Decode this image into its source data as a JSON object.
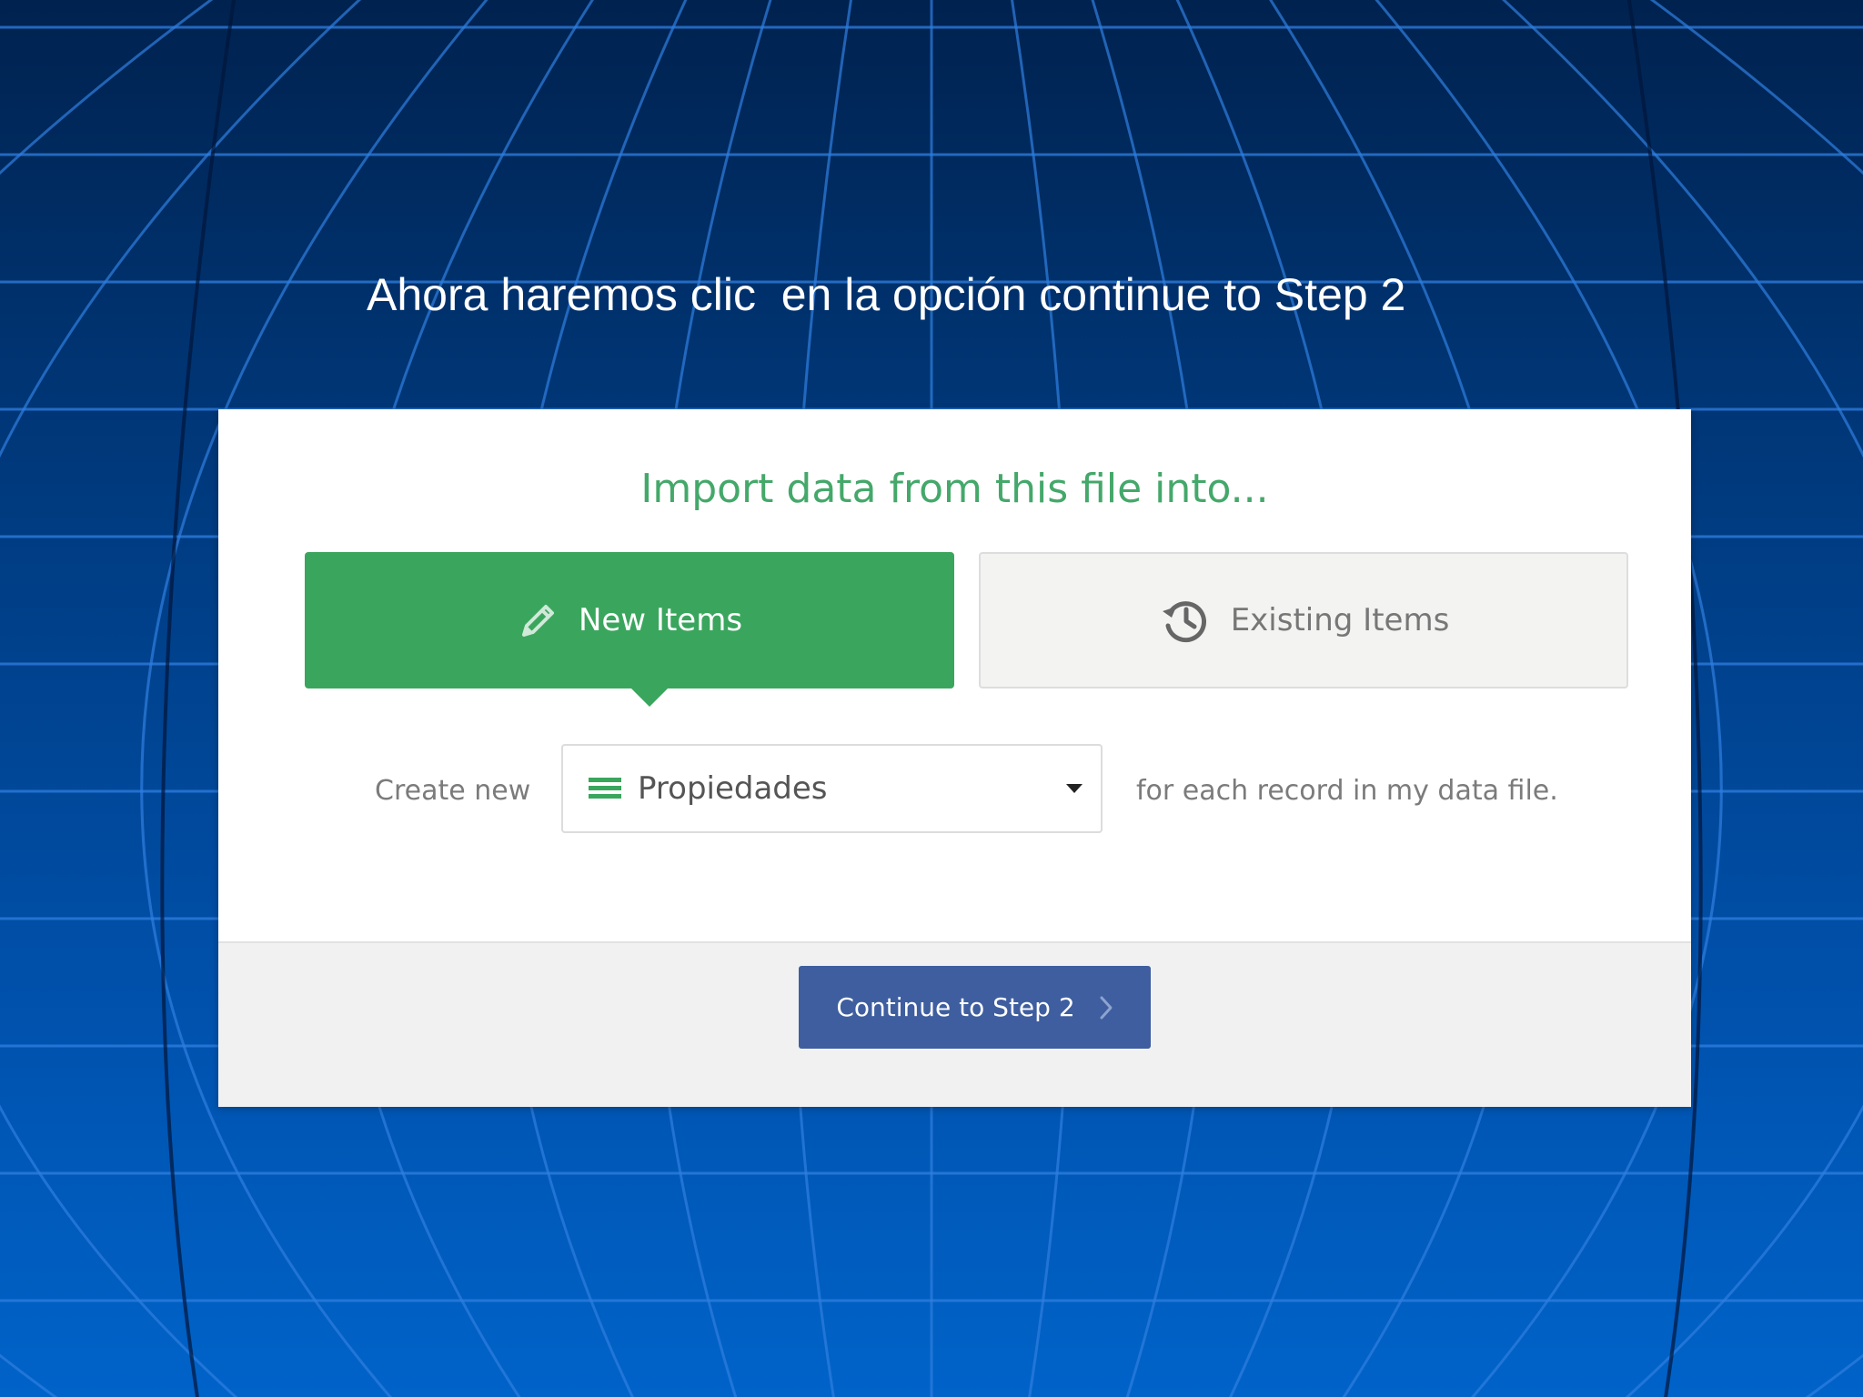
{
  "slide": {
    "title": "Ahora haremos clic  en la opción continue to Step 2"
  },
  "dialog": {
    "heading": "Import data from this file into...",
    "options": {
      "new_items": {
        "label": "New Items",
        "icon": "pencil-icon",
        "selected": true
      },
      "existing_items": {
        "label": "Existing Items",
        "icon": "history-icon",
        "selected": false
      }
    },
    "create_prefix": "Create new",
    "select": {
      "value": "Propiedades",
      "icon": "list-icon"
    },
    "create_suffix": "for each record in my data file.",
    "continue_button": {
      "label": "Continue to Step 2",
      "icon": "chevron-right-icon"
    }
  },
  "colors": {
    "accent_green": "#3aa65d",
    "heading_green": "#44a86a",
    "button_blue": "#3e5e9f",
    "background_top": "#00224f",
    "background_bottom": "#0063c9"
  }
}
